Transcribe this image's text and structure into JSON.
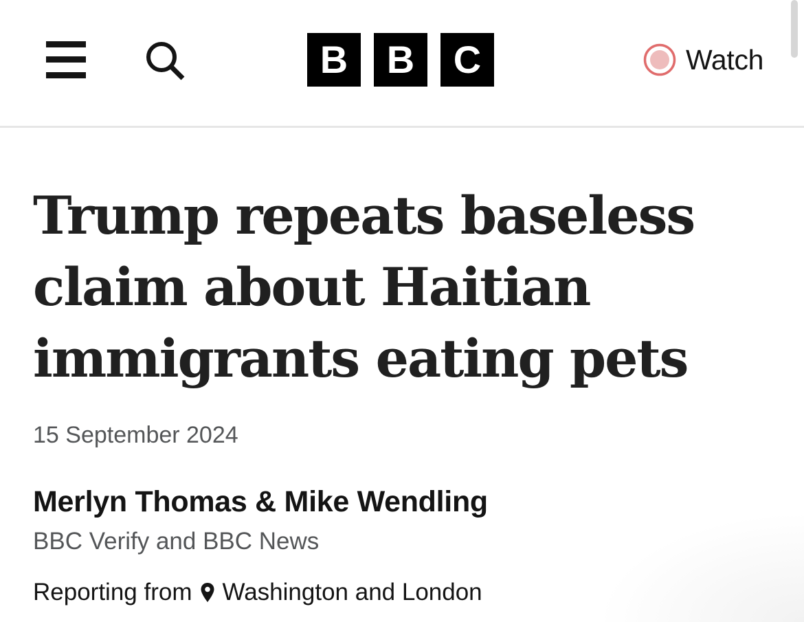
{
  "header": {
    "menu_icon": "hamburger-menu-icon",
    "search_icon": "search-icon",
    "logo_letters": [
      "B",
      "B",
      "C"
    ],
    "watch": {
      "label": "Watch",
      "icon": "live-record-icon",
      "icon_color": "#e06c6c"
    }
  },
  "article": {
    "headline": "Trump repeats baseless claim about Haitian immigrants eating pets",
    "date": "15 September 2024",
    "authors": "Merlyn Thomas & Mike Wendling",
    "organisation": "BBC Verify and BBC News",
    "reporting_from": {
      "label": "Reporting from",
      "icon": "location-pin-icon",
      "location": "Washington and London"
    }
  }
}
